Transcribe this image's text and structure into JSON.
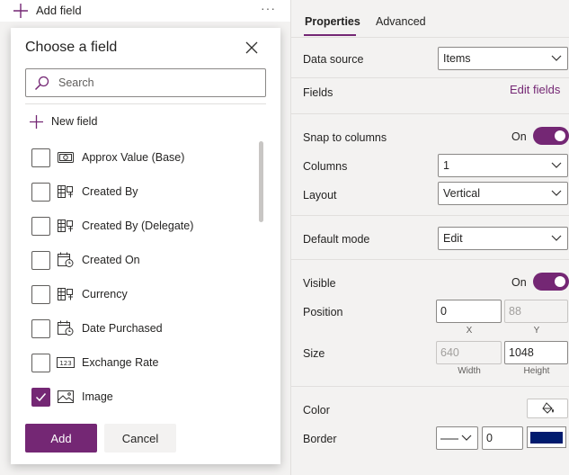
{
  "top_bar": {
    "add_field_label": "Add field",
    "more_label": "···"
  },
  "dialog": {
    "title": "Choose a field",
    "search_placeholder": "Search",
    "new_field_label": "New field",
    "fields": [
      {
        "label": "Approx Value (Base)",
        "icon": "currency-icon",
        "checked": false
      },
      {
        "label": "Created By",
        "icon": "lookup-icon",
        "checked": false
      },
      {
        "label": "Created By (Delegate)",
        "icon": "lookup-icon",
        "checked": false
      },
      {
        "label": "Created On",
        "icon": "calendar-clock-icon",
        "checked": false
      },
      {
        "label": "Currency",
        "icon": "lookup-icon",
        "checked": false
      },
      {
        "label": "Date Purchased",
        "icon": "calendar-clock-icon",
        "checked": false
      },
      {
        "label": "Exchange Rate",
        "icon": "number-icon",
        "checked": false
      },
      {
        "label": "Image",
        "icon": "image-icon",
        "checked": true
      }
    ],
    "add_label": "Add",
    "cancel_label": "Cancel"
  },
  "panel": {
    "tabs": [
      {
        "label": "Properties",
        "active": true
      },
      {
        "label": "Advanced",
        "active": false
      }
    ],
    "data_source": {
      "label": "Data source",
      "value": "Items"
    },
    "fields": {
      "label": "Fields",
      "link": "Edit fields"
    },
    "snap_to_columns": {
      "label": "Snap to columns",
      "state": "On"
    },
    "columns": {
      "label": "Columns",
      "value": "1"
    },
    "layout": {
      "label": "Layout",
      "value": "Vertical"
    },
    "default_mode": {
      "label": "Default mode",
      "value": "Edit"
    },
    "visible": {
      "label": "Visible",
      "state": "On"
    },
    "position": {
      "label": "Position",
      "x": "0",
      "y": "88",
      "x_label": "X",
      "y_label": "Y"
    },
    "size": {
      "label": "Size",
      "width": "640",
      "height": "1048",
      "width_label": "Width",
      "height_label": "Height"
    },
    "color": {
      "label": "Color"
    },
    "border": {
      "label": "Border",
      "thickness": "0",
      "color": "#001B6E"
    }
  },
  "colors": {
    "accent": "#742774"
  }
}
